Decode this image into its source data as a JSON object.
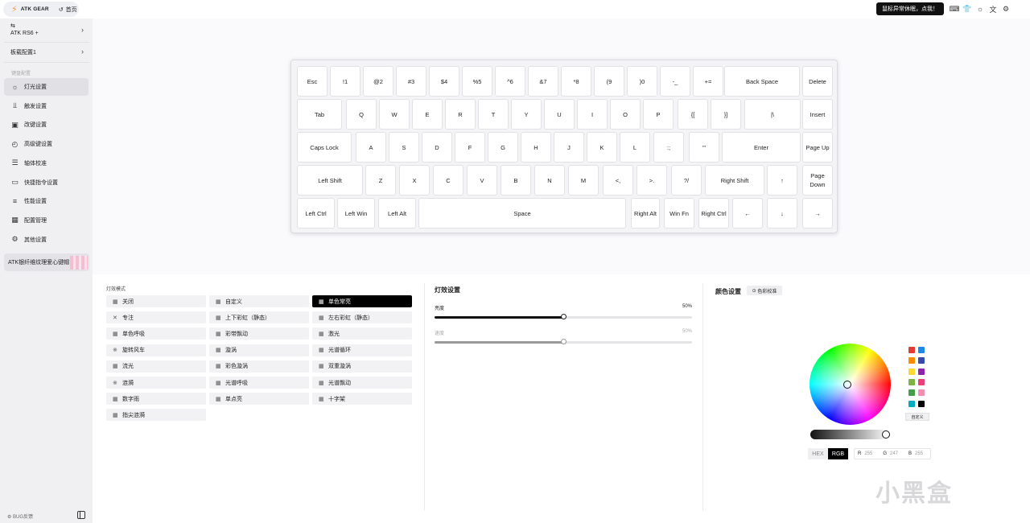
{
  "topbar": {
    "brand": "ATK GEAR",
    "home": "首页",
    "toast": "鼠标异常休眠，点我！",
    "icons": [
      "keyboard-icon",
      "shirt-icon",
      "sun-icon",
      "translate-icon",
      "settings-icon"
    ]
  },
  "sidebar": {
    "device": "ATK RS6 +",
    "config": "板载配置1",
    "section": "键盘配置",
    "items": [
      {
        "label": "灯光设置",
        "icon": "bulb-icon",
        "active": true
      },
      {
        "label": "触发设置",
        "icon": "trigger-icon"
      },
      {
        "label": "改键设置",
        "icon": "remap-icon"
      },
      {
        "label": "高级键设置",
        "icon": "advanced-icon"
      },
      {
        "label": "轴体校准",
        "icon": "calibrate-icon"
      },
      {
        "label": "快捷指令设置",
        "icon": "terminal-icon"
      },
      {
        "label": "性能设置",
        "icon": "sliders-icon"
      },
      {
        "label": "配置管理",
        "icon": "grid-icon"
      },
      {
        "label": "其他设置",
        "icon": "gear-icon"
      }
    ],
    "promo": "ATK银纤维纹理爱心键帽",
    "bug": "BUG反馈"
  },
  "keyboard": {
    "rows": [
      [
        "Esc",
        "!1",
        "@2",
        "#3",
        "$4",
        "%5",
        "^6",
        "&7",
        "*8",
        "(9",
        ")0",
        "-_",
        "+=",
        "Back Space",
        "Delete"
      ],
      [
        "Tab",
        "Q",
        "W",
        "E",
        "R",
        "T",
        "Y",
        "U",
        "I",
        "O",
        "P",
        "{[",
        "}]",
        "|\\",
        "Insert"
      ],
      [
        "Caps Lock",
        "A",
        "S",
        "D",
        "F",
        "G",
        "H",
        "J",
        "K",
        "L",
        ":;",
        "\"'",
        "Enter",
        "Page Up"
      ],
      [
        "Left Shift",
        "Z",
        "X",
        "C",
        "V",
        "B",
        "N",
        "M",
        "<,",
        ">.",
        "?/",
        "Right Shift",
        "↑",
        "Page Down"
      ],
      [
        "Left Ctrl",
        "Left Win",
        "Left Alt",
        "Space",
        "Right Alt",
        "Win Fn",
        "Right Ctrl",
        "←",
        "↓",
        "→"
      ]
    ]
  },
  "lighting": {
    "mode_title": "灯效模式",
    "modes": [
      [
        "关闭",
        "自定义",
        "单色常亮"
      ],
      [
        "专注",
        "上下彩虹（静态）",
        "左右彩虹（静态）"
      ],
      [
        "单色呼吸",
        "彩带飘动",
        "激光"
      ],
      [
        "旋转风车",
        "漩涡",
        "光谱循环"
      ],
      [
        "流光",
        "彩色漩涡",
        "双重漩涡"
      ],
      [
        "涟漪",
        "光谱呼吸",
        "光谱飘动"
      ],
      [
        "数字雨",
        "单点亮",
        "十字架"
      ],
      [
        "指尖涟漪"
      ]
    ],
    "selected": "单色常亮"
  },
  "effect": {
    "title": "灯效设置",
    "brightness_label": "亮度",
    "brightness_value": "50%",
    "brightness": 0.5,
    "speed_label": "速度",
    "speed_value": "50%",
    "speed": 0.5
  },
  "color": {
    "title": "颜色设置",
    "calibrate": "色彩校准",
    "custom": "自定义",
    "hex_label": "HEX",
    "rgb_label": "RGB",
    "r_label": "R",
    "r": "255",
    "g_label": "G",
    "g": "247",
    "b_label": "B",
    "b": "255",
    "swatches": [
      "#e53935",
      "#1e88e5",
      "#fb8c00",
      "#3949ab",
      "#fdd835",
      "#8e24aa",
      "#7cb342",
      "#ec407a",
      "#43a047",
      "#f48fb1",
      "#00acc1",
      "#000000"
    ]
  },
  "watermark": "小黑盒"
}
